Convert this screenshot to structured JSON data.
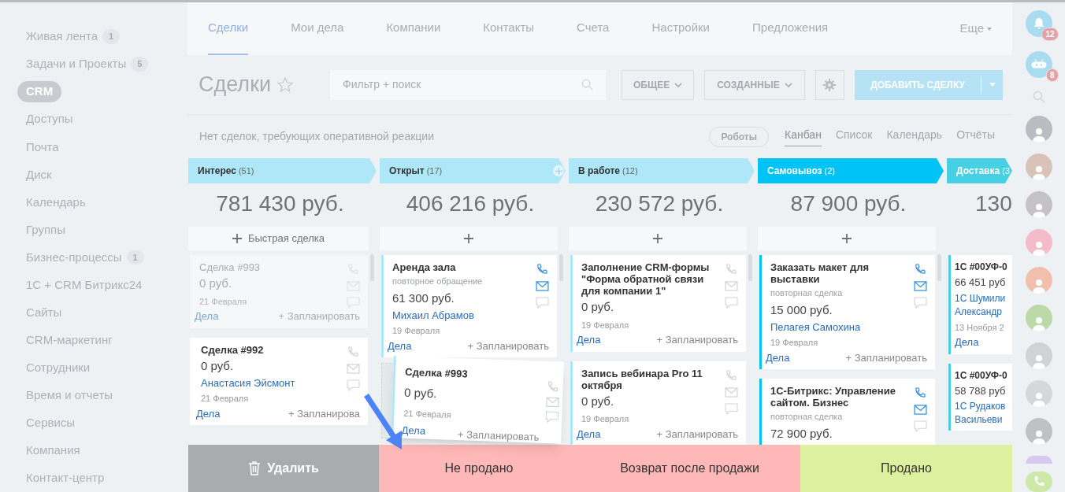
{
  "sidebar": {
    "items": [
      {
        "label": "Живая лента",
        "badge": "1",
        "selected": false
      },
      {
        "label": "Задачи и Проекты",
        "badge": "5",
        "selected": false
      },
      {
        "label": "CRM",
        "selected": true
      },
      {
        "label": "Доступы",
        "selected": false
      },
      {
        "label": "Почта",
        "selected": false
      },
      {
        "label": "Диск",
        "selected": false
      },
      {
        "label": "Календарь",
        "selected": false
      },
      {
        "label": "Группы",
        "selected": false
      },
      {
        "label": "Бизнес-процессы",
        "badge": "1",
        "selected": false
      },
      {
        "label": "1С + CRM Битрикс24",
        "selected": false
      },
      {
        "label": "Сайты",
        "selected": false
      },
      {
        "label": "CRM-маркетинг",
        "selected": false
      },
      {
        "label": "Сотрудники",
        "selected": false
      },
      {
        "label": "Время и отчеты",
        "selected": false
      },
      {
        "label": "Сервисы",
        "selected": false
      },
      {
        "label": "Компания",
        "selected": false
      },
      {
        "label": "Контакт-центр",
        "selected": false
      }
    ]
  },
  "top_tabs": [
    {
      "label": "Сделки",
      "selected": true
    },
    {
      "label": "Мои дела",
      "selected": false
    },
    {
      "label": "Компании",
      "selected": false
    },
    {
      "label": "Контакты",
      "selected": false
    },
    {
      "label": "Счета",
      "selected": false
    },
    {
      "label": "Настройки",
      "selected": false
    },
    {
      "label": "Предложения",
      "selected": false
    }
  ],
  "more": "Еще",
  "header": {
    "title": "Сделки",
    "search_placeholder": "Фильтр + поиск",
    "filters": [
      "ОБЩЕЕ",
      "СОЗДАННЫЕ"
    ],
    "add_button": "ДОБАВИТЬ СДЕЛКУ"
  },
  "notice": "Нет сделок, требующих оперативной реакции",
  "robots_button": "Роботы",
  "views": [
    {
      "label": "Канбан",
      "selected": true
    },
    {
      "label": "Список",
      "selected": false
    },
    {
      "label": "Календарь",
      "selected": false
    },
    {
      "label": "Отчёты",
      "selected": false
    }
  ],
  "columns": [
    {
      "name": "Интерес",
      "count": "(51)",
      "color": "#aee8f8",
      "total": "781 430 руб.",
      "quick_add": "Быстрая сделка",
      "cards": [
        {
          "kind": "ghost",
          "title": "Сделка #993",
          "amount": "0 руб.",
          "date": "21 Февраля",
          "tasks": "Дела",
          "plan": "+ Запланировать",
          "channels_active": false
        },
        {
          "kind": "card",
          "title": "Сделка #992",
          "amount": "0 руб.",
          "contact": "Анастасия Эйсмонт",
          "date": "21 Февраля",
          "tasks": "Дела",
          "plan": "+ Запланирова",
          "channels_active": false
        }
      ]
    },
    {
      "name": "Открыт",
      "count": "(17)",
      "color": "#aee8f8",
      "total": "406 216 руб.",
      "cards": [
        {
          "kind": "card",
          "title": "Аренда зала",
          "subtitle": "повторное обращение",
          "amount": "61 300 руб.",
          "contact": "Михаил Абрамов",
          "date": "19 Февраля",
          "tasks": "Дела",
          "plan": "+ Запланировать",
          "channels_active": true
        },
        {
          "kind": "placeholder"
        }
      ]
    },
    {
      "name": "В работе",
      "count": "(12)",
      "color": "#aee8f8",
      "total": "230 572 руб.",
      "cards": [
        {
          "kind": "card",
          "title": "Заполнение CRM-формы \"Форма обратной связи для компании 1\"",
          "amount": "0 руб.",
          "date": "19 Февраля",
          "tasks": "Дела",
          "plan": "+ Запланировать",
          "channels_active": false
        },
        {
          "kind": "card",
          "title": "Запись вебинара Pro 11 октября",
          "amount": "0 руб.",
          "date": "19 Февраля",
          "tasks": "Дела",
          "plan": "+ Запланировать",
          "channels_active": false
        }
      ]
    },
    {
      "name": "Самовывоз",
      "count": "(2)",
      "color": "#00c3f5",
      "total": "87 900 руб.",
      "cards": [
        {
          "kind": "card",
          "title": "Заказать макет для выставки",
          "subtitle": "повторная сделка",
          "amount": "15 000 руб.",
          "contact": "Пелагея Самохина",
          "date": "19 Февраля",
          "tasks": "Дела",
          "plan": "+ Запланировать",
          "channels_active": true
        },
        {
          "kind": "card",
          "title": "1С-Битрикс: Управление сайтом. Бизнес",
          "subtitle": "повторная сделка",
          "amount": "72 900 руб.",
          "channels_active": true
        }
      ]
    },
    {
      "name": "Доставка",
      "count": "(3",
      "color": "#47cfe3",
      "total": "130",
      "cards": [
        {
          "kind": "card",
          "title": "1С #00УФ-0",
          "amount": "66 451 руб",
          "contact": "1С Шумили Александр",
          "date": "13 Ноября 2",
          "tasks": "Дела"
        },
        {
          "kind": "card",
          "title": "1С #00УФ-0",
          "amount": "58 788 руб",
          "contact": "1С Рудаков Васильеви"
        }
      ]
    }
  ],
  "drag_card": {
    "title": "Сделка #993",
    "amount": "0 руб.",
    "date": "21 Февраля",
    "tasks": "Дела",
    "plan": "+ Запланировать"
  },
  "drop_zones": [
    {
      "kind": "delete",
      "label": "Удалить"
    },
    {
      "kind": "lost",
      "label": "Не продано"
    },
    {
      "kind": "lost",
      "label": "Возврат после продажи"
    },
    {
      "kind": "won",
      "label": "Продано"
    }
  ],
  "right_bar": {
    "notifications": "12",
    "bot_badge": "8",
    "avatars": [
      {
        "color": "#b9bcc0"
      },
      {
        "color": "#d9c3b8"
      },
      {
        "color": "#c4c2c6"
      },
      {
        "color": "#f4bccb"
      },
      {
        "color": "#f0bfae"
      },
      {
        "color": "#bcd9a8"
      },
      {
        "color": "#cfd3d6"
      },
      {
        "color": "#d5d7d9"
      },
      {
        "color": "#bfc1c3"
      },
      {
        "color": "#d6c8ee"
      }
    ]
  }
}
